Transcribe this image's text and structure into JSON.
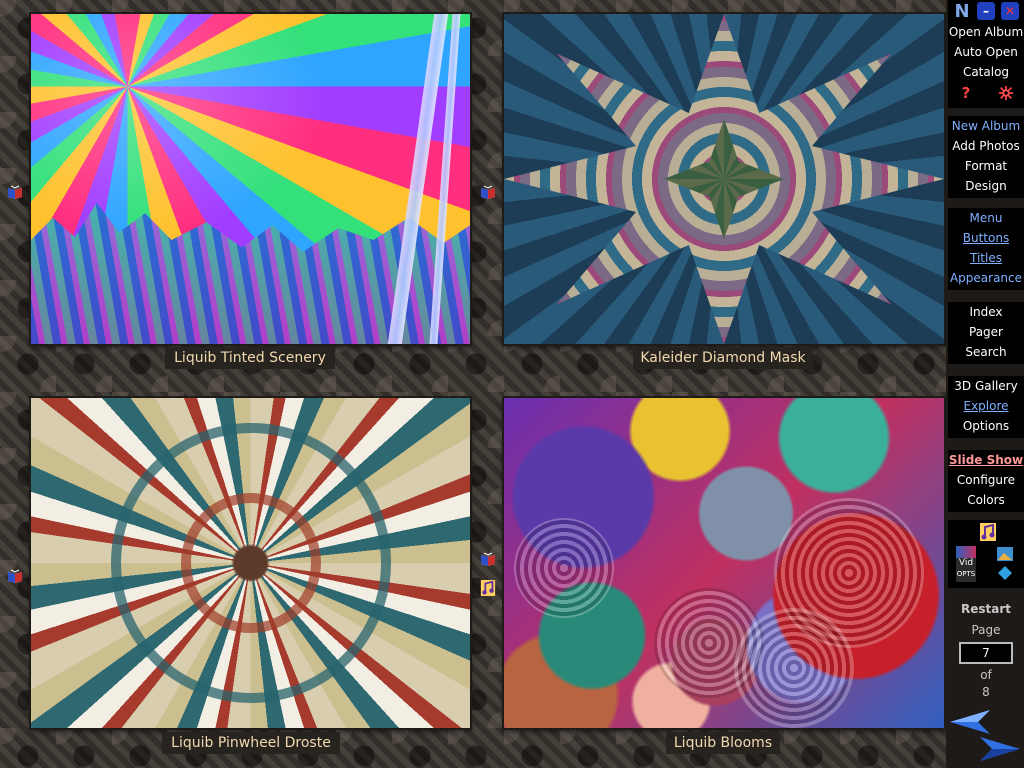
{
  "gallery": {
    "photos": [
      {
        "caption": "Liquib Tinted Scenery"
      },
      {
        "caption": "Kaleider Diamond Mask"
      },
      {
        "caption": "Liquib Pinwheel Droste"
      },
      {
        "caption": "Liquib Blooms"
      }
    ]
  },
  "panel": {
    "titlebar": {
      "logo": "N",
      "minimize": "–",
      "close": "✕"
    },
    "group1": {
      "open_album": "Open Album",
      "auto_open": "Auto Open",
      "catalog": "Catalog",
      "help": "?",
      "settings_icon": "gear-icon"
    },
    "group2": {
      "new_album": "New Album",
      "add_photos": "Add Photos",
      "format": "Format",
      "design": "Design"
    },
    "group3": {
      "menu": "Menu",
      "buttons": "Buttons",
      "titles": "Titles",
      "appearance": "Appearance"
    },
    "group4": {
      "index": "Index",
      "pager": "Pager",
      "search": "Search"
    },
    "group5": {
      "gallery_3d": "3D Gallery",
      "explore": "Explore",
      "options": "Options"
    },
    "group6": {
      "slide_show": "Slide Show",
      "configure": "Configure",
      "colors": "Colors"
    },
    "group7": {
      "vid_label": "Vid",
      "vid_sub": "OPTS"
    },
    "pager": {
      "restart": "Restart",
      "page_label": "Page",
      "page_value": "7",
      "of_label": "of",
      "total_pages": "8"
    }
  },
  "colors": {
    "caption_text": "#f1d9b0",
    "panel_link": "#7fb0ff",
    "slide_show": "#ff9898"
  }
}
